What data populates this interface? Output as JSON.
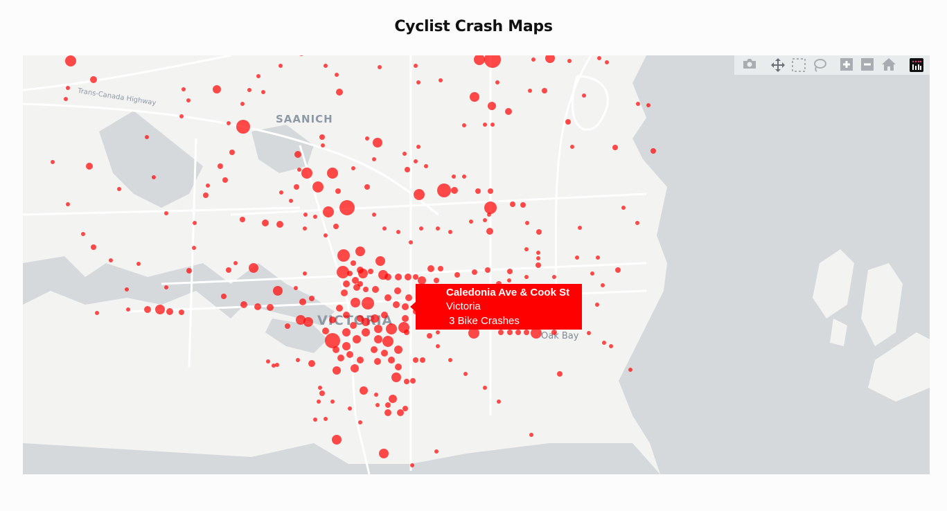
{
  "page": {
    "title": "Cyclist Crash Maps"
  },
  "map": {
    "place_labels": {
      "saanich": "SAANICH",
      "victoria": "VICTORIA",
      "oak_bay": "Oak Bay",
      "highway": "Trans-Canada Highway"
    },
    "marker_color": "#ff0000",
    "land_color": "#f3f3f2",
    "water_color": "#d5d9dc"
  },
  "tooltip": {
    "location": "Caledonia Ave & Cook St",
    "city": "Victoria",
    "count_text": " 3 Bike Crashes",
    "crash_count": 3
  },
  "modebar": {
    "buttons": [
      {
        "name": "download-plot",
        "icon": "camera-icon"
      },
      {
        "name": "pan",
        "icon": "move-icon"
      },
      {
        "name": "box-select",
        "icon": "box-select-icon"
      },
      {
        "name": "lasso-select",
        "icon": "lasso-icon"
      },
      {
        "name": "zoom-in",
        "icon": "plus-icon"
      },
      {
        "name": "zoom-out",
        "icon": "minus-icon"
      },
      {
        "name": "reset-view",
        "icon": "home-icon"
      },
      {
        "name": "plotly-logo",
        "icon": "plotly-logo-icon"
      }
    ]
  }
}
